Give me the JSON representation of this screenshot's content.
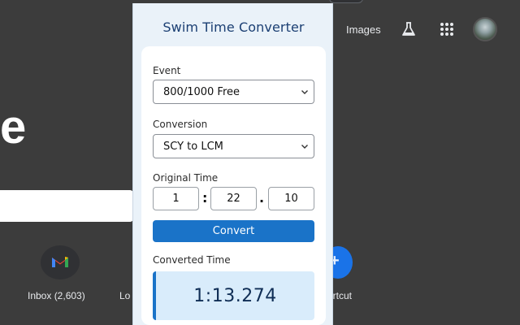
{
  "background": {
    "header": {
      "images_link": "Images",
      "labs_icon": "flask-icon",
      "apps_icon": "apps-grid-icon"
    },
    "logo_fragment": "e",
    "shortcuts": [
      {
        "label": "Inbox (2,603)",
        "icon": "gmail-icon"
      },
      {
        "label": "Lo",
        "icon": ""
      },
      {
        "label": "ortcut",
        "icon": "plus-icon"
      }
    ]
  },
  "popup": {
    "title": "Swim Time Converter",
    "event": {
      "label": "Event",
      "value": "800/1000 Free"
    },
    "conversion": {
      "label": "Conversion",
      "value": "SCY to LCM"
    },
    "original_time": {
      "label": "Original Time",
      "minutes": "1",
      "seconds": "22",
      "hundredths": "10",
      "sep1": ":",
      "sep2": "."
    },
    "convert_button": "Convert",
    "result": {
      "label": "Converted Time",
      "value": "1:13.274"
    }
  },
  "colors": {
    "accent": "#1a73c8",
    "popup_bg": "#eaf2f9",
    "result_bg": "#d9ecfb",
    "title": "#1b3f73",
    "page_bg": "#3c3c3c"
  }
}
